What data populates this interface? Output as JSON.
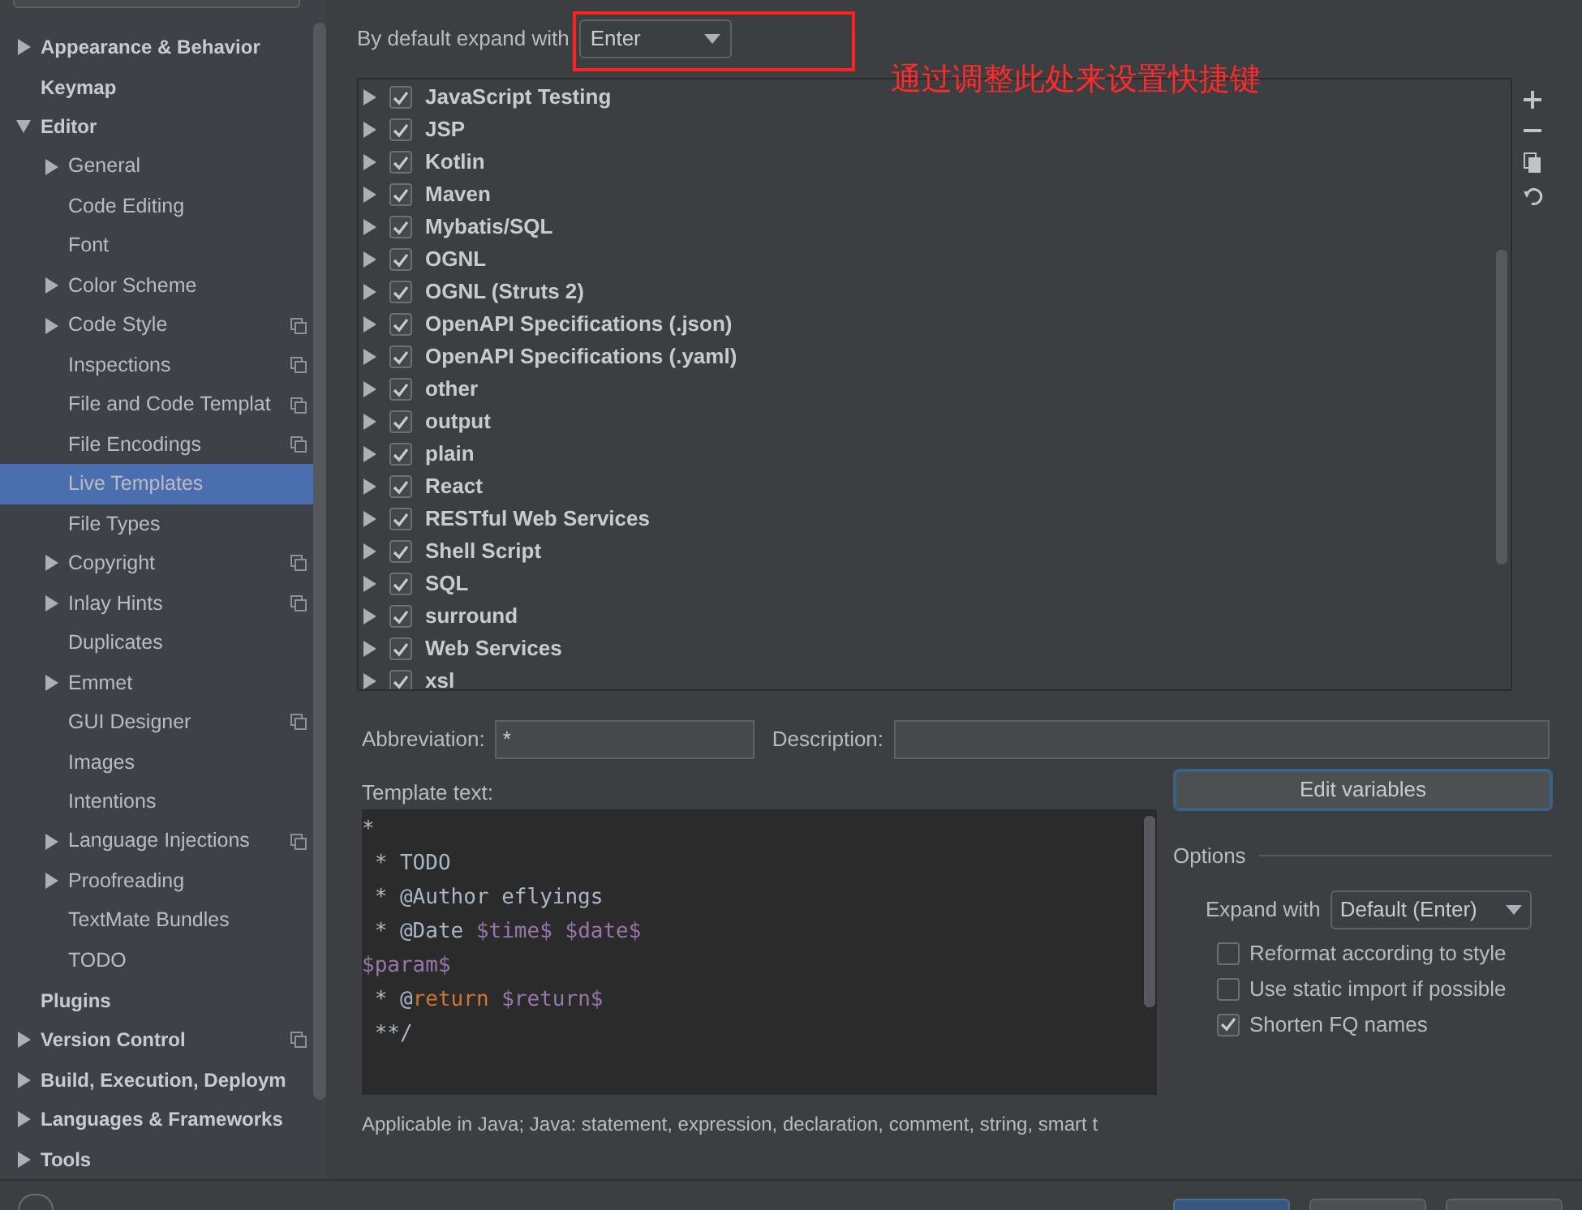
{
  "sidebar": {
    "items": [
      {
        "label": "Appearance & Behavior",
        "expanded": false,
        "selected": false,
        "project_level": false
      },
      {
        "label": "Keymap",
        "selected": false,
        "project_level": false
      },
      {
        "label": "Editor",
        "expanded": true,
        "selected": false,
        "project_level": false,
        "children": [
          {
            "label": "General",
            "expanded": false,
            "selected": false,
            "project_level": false
          },
          {
            "label": "Code Editing",
            "selected": false,
            "project_level": false
          },
          {
            "label": "Font",
            "selected": false,
            "project_level": false
          },
          {
            "label": "Color Scheme",
            "expanded": false,
            "selected": false,
            "project_level": false
          },
          {
            "label": "Code Style",
            "expanded": false,
            "selected": false,
            "project_level": true
          },
          {
            "label": "Inspections",
            "selected": false,
            "project_level": true
          },
          {
            "label": "File and Code Templat",
            "selected": false,
            "project_level": true
          },
          {
            "label": "File Encodings",
            "selected": false,
            "project_level": true
          },
          {
            "label": "Live Templates",
            "selected": true,
            "project_level": false
          },
          {
            "label": "File Types",
            "selected": false,
            "project_level": false
          },
          {
            "label": "Copyright",
            "expanded": false,
            "selected": false,
            "project_level": true
          },
          {
            "label": "Inlay Hints",
            "expanded": false,
            "selected": false,
            "project_level": true
          },
          {
            "label": "Duplicates",
            "selected": false,
            "project_level": false
          },
          {
            "label": "Emmet",
            "expanded": false,
            "selected": false,
            "project_level": false
          },
          {
            "label": "GUI Designer",
            "selected": false,
            "project_level": true
          },
          {
            "label": "Images",
            "selected": false,
            "project_level": false
          },
          {
            "label": "Intentions",
            "selected": false,
            "project_level": false
          },
          {
            "label": "Language Injections",
            "expanded": false,
            "selected": false,
            "project_level": true
          },
          {
            "label": "Proofreading",
            "expanded": false,
            "selected": false,
            "project_level": false
          },
          {
            "label": "TextMate Bundles",
            "selected": false,
            "project_level": false
          },
          {
            "label": "TODO",
            "selected": false,
            "project_level": false
          }
        ]
      },
      {
        "label": "Plugins",
        "selected": false,
        "project_level": false
      },
      {
        "label": "Version Control",
        "expanded": false,
        "selected": false,
        "project_level": true
      },
      {
        "label": "Build, Execution, Deploym",
        "expanded": false,
        "selected": false,
        "project_level": false
      },
      {
        "label": "Languages & Frameworks",
        "expanded": false,
        "selected": false,
        "project_level": false
      },
      {
        "label": "Tools",
        "expanded": false,
        "selected": false,
        "project_level": false
      }
    ]
  },
  "expand_setting": {
    "label": "By default expand with",
    "value": "Enter"
  },
  "annotation": {
    "text": "通过调整此处来设置快捷键"
  },
  "template_groups": [
    {
      "name": "JavaScript Testing",
      "checked": true,
      "expanded": false
    },
    {
      "name": "JSP",
      "checked": true,
      "expanded": false
    },
    {
      "name": "Kotlin",
      "checked": true,
      "expanded": false
    },
    {
      "name": "Maven",
      "checked": true,
      "expanded": false
    },
    {
      "name": "Mybatis/SQL",
      "checked": true,
      "expanded": false
    },
    {
      "name": "OGNL",
      "checked": true,
      "expanded": false
    },
    {
      "name": "OGNL (Struts 2)",
      "checked": true,
      "expanded": false
    },
    {
      "name": "OpenAPI Specifications (.json)",
      "checked": true,
      "expanded": false
    },
    {
      "name": "OpenAPI Specifications (.yaml)",
      "checked": true,
      "expanded": false
    },
    {
      "name": "other",
      "checked": true,
      "expanded": false
    },
    {
      "name": "output",
      "checked": true,
      "expanded": false
    },
    {
      "name": "plain",
      "checked": true,
      "expanded": false
    },
    {
      "name": "React",
      "checked": true,
      "expanded": false
    },
    {
      "name": "RESTful Web Services",
      "checked": true,
      "expanded": false
    },
    {
      "name": "Shell Script",
      "checked": true,
      "expanded": false
    },
    {
      "name": "SQL",
      "checked": true,
      "expanded": false
    },
    {
      "name": "surround",
      "checked": true,
      "expanded": false
    },
    {
      "name": "Web Services",
      "checked": true,
      "expanded": false
    },
    {
      "name": "xsl",
      "checked": true,
      "expanded": false
    }
  ],
  "abbreviation": {
    "label": "Abbreviation:",
    "value": "*"
  },
  "description": {
    "label": "Description:"
  },
  "template_text": {
    "label": "Template text:",
    "lines": [
      [
        {
          "text": "*",
          "kind": "plain"
        }
      ],
      [
        {
          "text": " * TODO",
          "kind": "plain"
        }
      ],
      [
        {
          "text": " * @Author eflyings",
          "kind": "plain"
        }
      ],
      [
        {
          "text": " * @Date ",
          "kind": "plain"
        },
        {
          "text": "$time$",
          "kind": "variable"
        },
        {
          "text": " $date$",
          "kind": "variable"
        }
      ],
      [
        {
          "text": "$param$",
          "kind": "variable"
        }
      ],
      [
        {
          "text": " * @",
          "kind": "plain"
        },
        {
          "text": "return",
          "kind": "keyword"
        },
        {
          "text": " $return$",
          "kind": "variable"
        }
      ],
      [
        {
          "text": " **/",
          "kind": "plain"
        }
      ]
    ]
  },
  "edit_variables_button": "Edit variables",
  "options": {
    "title": "Options",
    "expand_with": {
      "label": "Expand with",
      "value": "Default (Enter)"
    },
    "checkboxes": [
      {
        "label": "Reformat according to style",
        "checked": false
      },
      {
        "label": "Use static import if possible",
        "checked": false
      },
      {
        "label": "Shorten FQ names",
        "checked": true
      }
    ]
  },
  "applicable": "Applicable in Java; Java: statement, expression, declaration, comment, string, smart t"
}
